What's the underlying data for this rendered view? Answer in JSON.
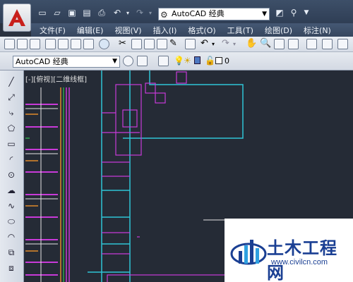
{
  "window": {
    "workspace_dropdown_value": "AutoCAD 经典"
  },
  "menu": {
    "items": [
      "文件(F)",
      "编辑(E)",
      "视图(V)",
      "插入(I)",
      "格式(O)",
      "工具(T)",
      "绘图(D)",
      "标注(N)"
    ]
  },
  "toolbar": {
    "workspace_select_value": "AutoCAD 经典",
    "layer_value": "0"
  },
  "canvas": {
    "viewport_label": "[-][俯视][二维线框]"
  },
  "watermark": {
    "name": "土木工程网",
    "url": "www.civilcn.com"
  },
  "colors": {
    "canvas_bg": "#252b36",
    "magenta": "#c83ad8",
    "cyan": "#2fc4d6",
    "orange": "#e08a2a",
    "green": "#2ea84a",
    "white": "#e6e6e6",
    "brand_blue": "#1a3f93"
  },
  "icons": {
    "app": "autocad-logo-icon",
    "qat": [
      "new-icon",
      "open-icon",
      "save-icon",
      "save-as-icon",
      "print-icon",
      "undo-icon",
      "redo-icon"
    ],
    "left": [
      "line-icon",
      "construction-line-icon",
      "polyline-icon",
      "polygon-icon",
      "rectangle-icon",
      "arc-icon",
      "circle-icon",
      "revision-cloud-icon",
      "spline-icon",
      "ellipse-icon",
      "ellipse-arc-icon",
      "insert-block-icon",
      "make-block-icon"
    ]
  }
}
